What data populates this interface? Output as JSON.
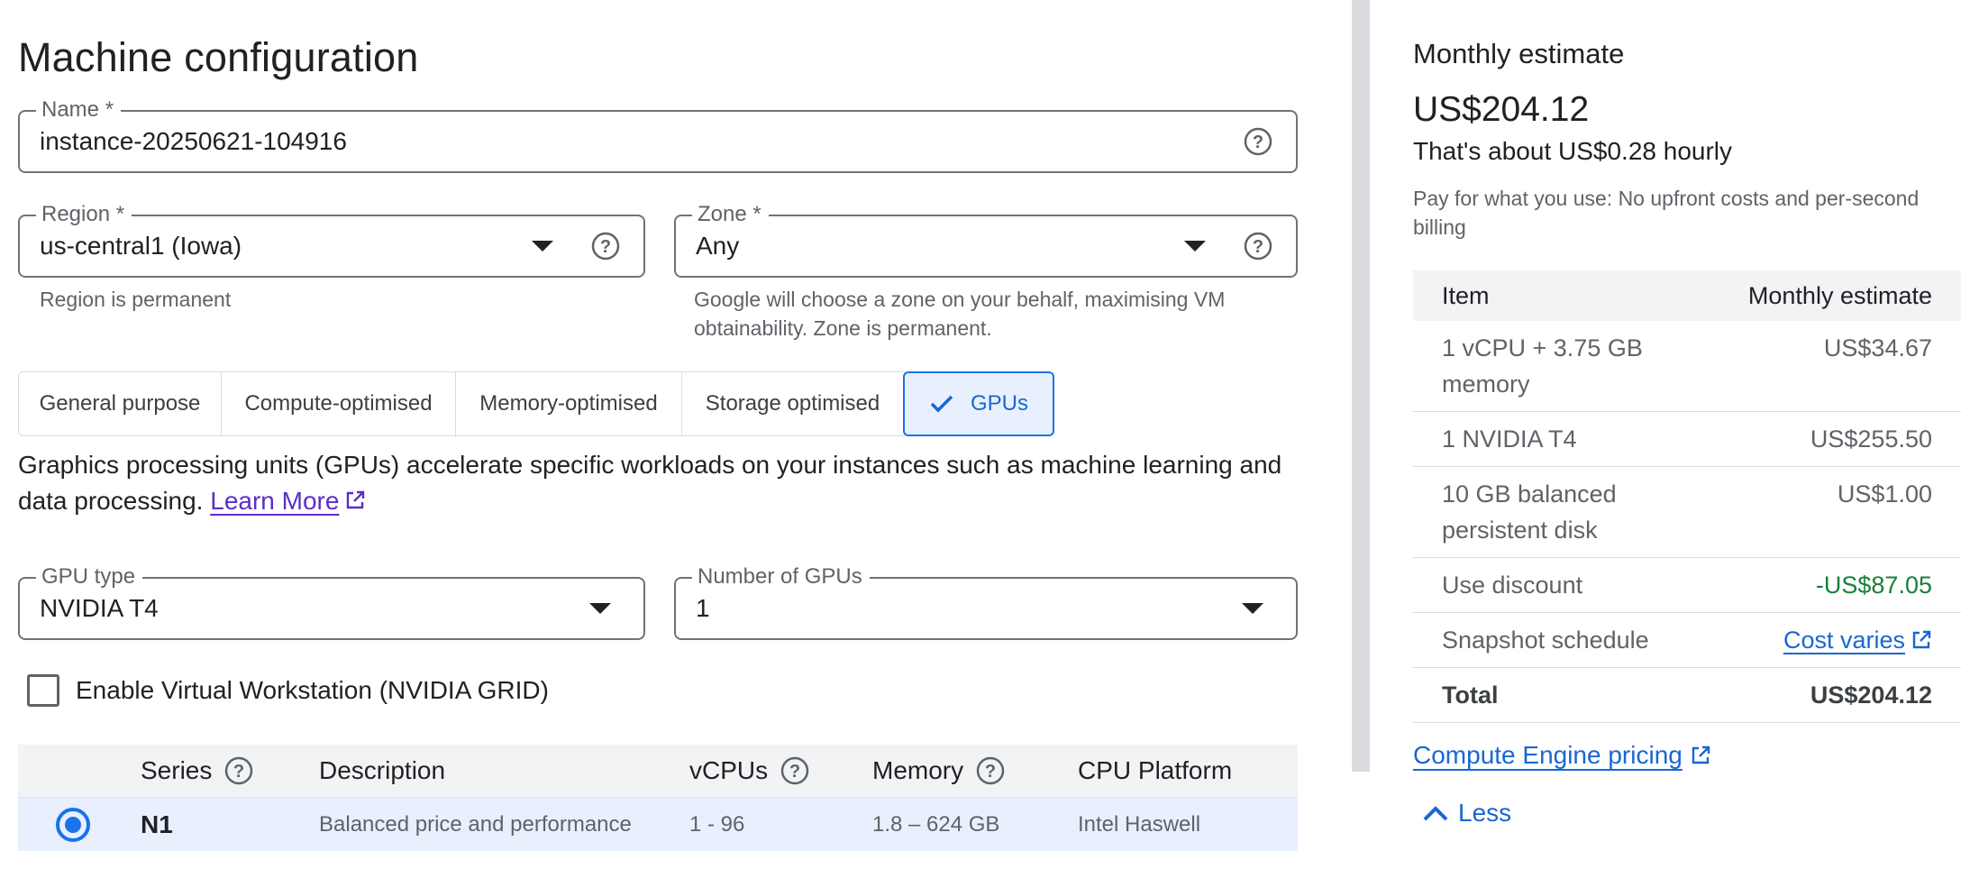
{
  "page_title": "Machine configuration",
  "name_field": {
    "label": "Name *",
    "value": "instance-20250621-104916"
  },
  "region_field": {
    "label": "Region *",
    "value": "us-central1 (Iowa)",
    "hint": "Region is permanent"
  },
  "zone_field": {
    "label": "Zone *",
    "value": "Any",
    "hint_line1": "Google will choose a zone on your behalf, maximising VM",
    "hint_line2": "obtainability. Zone is permanent."
  },
  "machine_tabs": [
    {
      "label": "General purpose",
      "active": false
    },
    {
      "label": "Compute-optimised",
      "active": false
    },
    {
      "label": "Memory-optimised",
      "active": false
    },
    {
      "label": "Storage optimised",
      "active": false
    },
    {
      "label": "GPUs",
      "active": true
    }
  ],
  "gpu_description": {
    "text": "Graphics processing units (GPUs) accelerate specific workloads on your instances such as machine learning and data processing. ",
    "link": "Learn More"
  },
  "gpu_type_field": {
    "label": "GPU type",
    "value": "NVIDIA T4"
  },
  "gpu_count_field": {
    "label": "Number of GPUs",
    "value": "1"
  },
  "virtual_workstation": {
    "label": "Enable Virtual Workstation (NVIDIA GRID)",
    "checked": false
  },
  "series_table": {
    "headers": {
      "series": "Series",
      "description": "Description",
      "vcpus": "vCPUs",
      "memory": "Memory",
      "cpu_platform": "CPU Platform"
    },
    "rows": [
      {
        "series": "N1",
        "description": "Balanced price and performance",
        "vcpus": "1 - 96",
        "memory": "1.8 – 624 GB",
        "cpu_platform": "Intel Haswell",
        "selected": true
      }
    ]
  },
  "estimate": {
    "title": "Monthly estimate",
    "amount": "US$204.12",
    "hourly": "That's about US$0.28 hourly",
    "note": "Pay for what you use: No upfront costs and per-second billing",
    "table_headers": {
      "item": "Item",
      "estimate": "Monthly estimate"
    },
    "rows": [
      {
        "item": "1 vCPU + 3.75 GB memory",
        "cost": "US$34.67"
      },
      {
        "item": "1 NVIDIA T4",
        "cost": "US$255.50"
      },
      {
        "item": "10 GB balanced persistent disk",
        "cost": "US$1.00"
      },
      {
        "item": "Use discount",
        "cost": "-US$87.05"
      },
      {
        "item": "Snapshot schedule",
        "cost": "Cost varies"
      },
      {
        "item": "Total",
        "cost": "US$204.12"
      }
    ],
    "pricing_link": "Compute Engine pricing",
    "less_label": "Less"
  },
  "colors": {
    "accent": "#1a73e8",
    "link_visited": "#5b2ec7",
    "discount_green": "#188038"
  }
}
